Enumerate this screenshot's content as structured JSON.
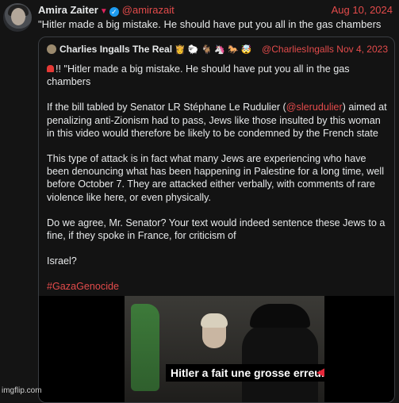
{
  "post": {
    "author_name": "Amira Zaiter",
    "author_handle": "@amirazait",
    "date": "Aug 10, 2024",
    "text": "\"Hitler made a big mistake. He should have put you all in the gas chambers"
  },
  "quoted_post": {
    "author_name": "Charlies Ingalls The Real",
    "emojis": "👸 🐑 🐐 🦄 🐎 🤯",
    "author_handle": "@CharliesIngalls",
    "date": "Nov 4, 2023",
    "p1": "!! \"Hitler made a big mistake. He should have put you all in the gas chambers",
    "p2_before": "If the bill tabled by Senator LR Stéphane Le Rudulier (",
    "p2_mention": "@slerudulier",
    "p2_after": ") aimed at penalizing anti-Zionism had to pass, Jews like those insulted by this woman in this video would therefore be likely to be condemned by the French state",
    "p3": "This type of attack is in fact what many Jews are experiencing who have been denouncing what has been happening in Palestine for a long time, well before October 7. They are attacked either verbally, with comments of rare violence like here, or even physically.",
    "p4": "Do we agree, Mr. Senator? Your text would indeed sentence these Jews to a fine, if they spoke in France, for criticism of",
    "p5": "Israel?",
    "hashtag": "#GazaGenocide"
  },
  "video": {
    "subtitle": "Hitler a fait une grosse erreur !"
  },
  "watermark": "imgflip.com",
  "colors": {
    "background": "#141414",
    "link": "#e34b4b",
    "verified": "#1d9bf0",
    "arrow": "#e8283a"
  }
}
